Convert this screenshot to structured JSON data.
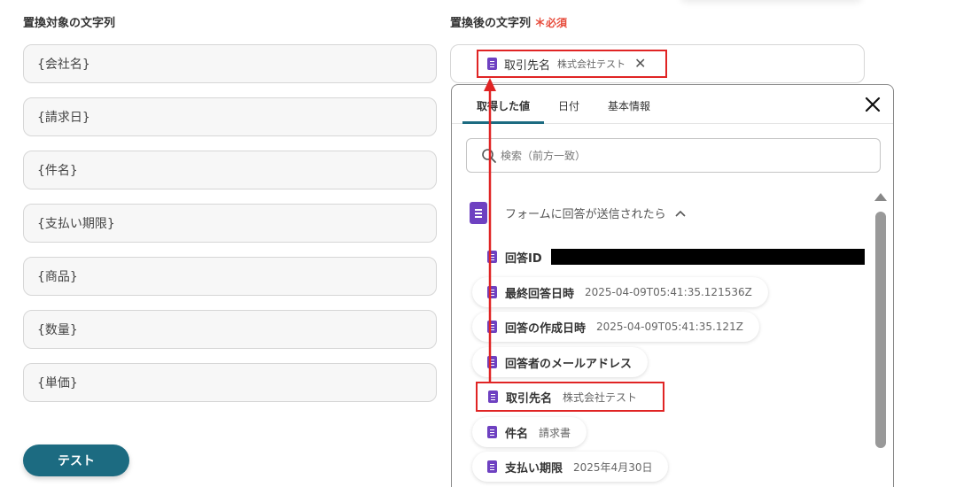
{
  "left_column": {
    "label": "置換対象の文字列",
    "fields": [
      "{会社名}",
      "{請求日}",
      "{件名}",
      "{支払い期限}",
      "{商品}",
      "{数量}",
      "{単価}"
    ],
    "test_button": "テスト"
  },
  "right_column": {
    "label": "置換後の文字列",
    "required_mark": "＊",
    "required_text": "必須",
    "selected_chip": {
      "label": "取引先名",
      "value": "株式会社テスト"
    }
  },
  "panel": {
    "tabs": [
      "取得した値",
      "日付",
      "基本情報"
    ],
    "active_tab": "取得した値",
    "search_placeholder": "検索（前方一致）",
    "group_title": "フォームに回答が送信されたら",
    "items": [
      {
        "label": "回答ID",
        "value": ""
      },
      {
        "label": "最終回答日時",
        "value": "2025-04-09T05:41:35.121536Z"
      },
      {
        "label": "回答の作成日時",
        "value": "2025-04-09T05:41:35.121Z"
      },
      {
        "label": "回答者のメールアドレス",
        "value": ""
      },
      {
        "label": "取引先名",
        "value": "株式会社テスト"
      },
      {
        "label": "件名",
        "value": "請求書"
      },
      {
        "label": "支払い期限",
        "value": "2025年4月30日"
      }
    ]
  },
  "colors": {
    "accent": "#1c6b81",
    "highlight": "#e02424",
    "form_icon": "#6e41c1",
    "required": "#e74c3c"
  }
}
